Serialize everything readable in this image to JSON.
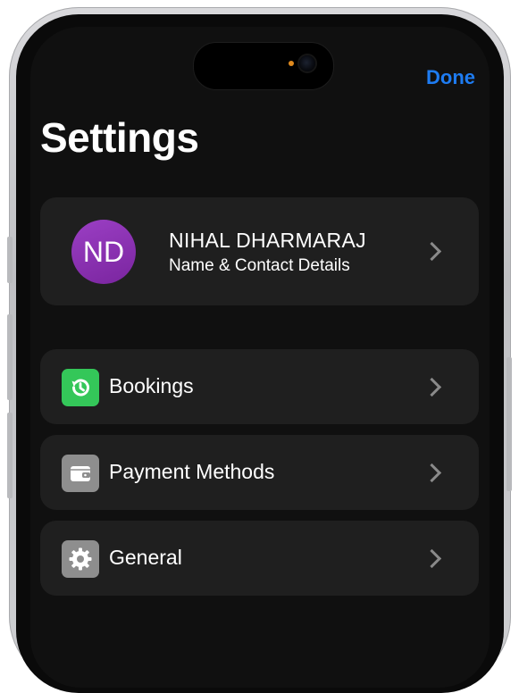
{
  "header": {
    "done_label": "Done",
    "title": "Settings"
  },
  "profile": {
    "initials": "ND",
    "name": "NIHAL DHARMARAJ",
    "subtitle": "Name & Contact Details",
    "avatar_color": "#8a2fb3"
  },
  "menu": [
    {
      "label": "Bookings",
      "icon": "history-icon",
      "icon_bg": "#34c759"
    },
    {
      "label": "Payment Methods",
      "icon": "wallet-icon",
      "icon_bg": "#8e8e8e"
    },
    {
      "label": "General",
      "icon": "gear-icon",
      "icon_bg": "#8e8e8e"
    }
  ],
  "colors": {
    "accent": "#1e7cf2",
    "background": "#101010",
    "card": "#1f1f1f"
  }
}
